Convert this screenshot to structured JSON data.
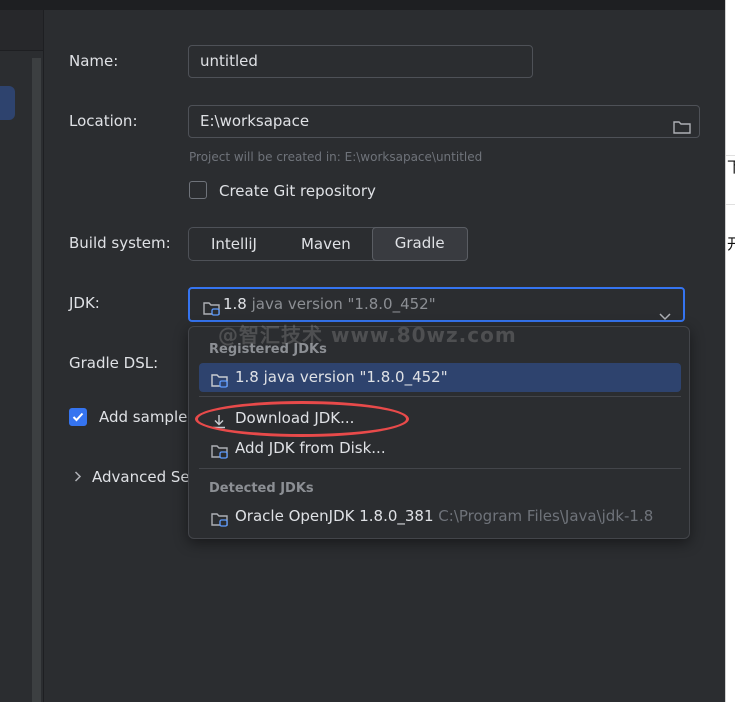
{
  "form": {
    "name_label": "Name:",
    "name_value": "untitled",
    "location_label": "Location:",
    "location_value": "E:\\worksapace",
    "location_hint": "Project will be created in: E:\\worksapace\\untitled",
    "git_label": "Create Git repository",
    "git_checked": false,
    "build_label": "Build system:",
    "build_options": [
      "IntelliJ",
      "Maven",
      "Gradle"
    ],
    "build_selected": "Gradle",
    "jdk_label": "JDK:",
    "jdk_version": "1.8",
    "jdk_desc": "java version \"1.8.0_452\"",
    "gradle_dsl_label": "Gradle DSL:",
    "sample_label": "Add sample",
    "sample_checked": true,
    "advanced_label": "Advanced Se"
  },
  "jdk_popup": {
    "registered_header": "Registered JDKs",
    "registered_item": "1.8 java version \"1.8.0_452\"",
    "download_item": "Download JDK...",
    "add_disk_item": "Add JDK from Disk...",
    "detected_header": "Detected JDKs",
    "detected_name": "Oracle OpenJDK 1.8.0_381",
    "detected_path": "C:\\Program Files\\Java\\jdk-1.8"
  },
  "watermark": "@智汇技术 www.80wz.com",
  "right_edge": {
    "glyph_1": "下",
    "glyph_2": "开"
  },
  "colors": {
    "accent": "#3574f0",
    "selection": "#2e436e",
    "annotation": "#e84a4a"
  }
}
